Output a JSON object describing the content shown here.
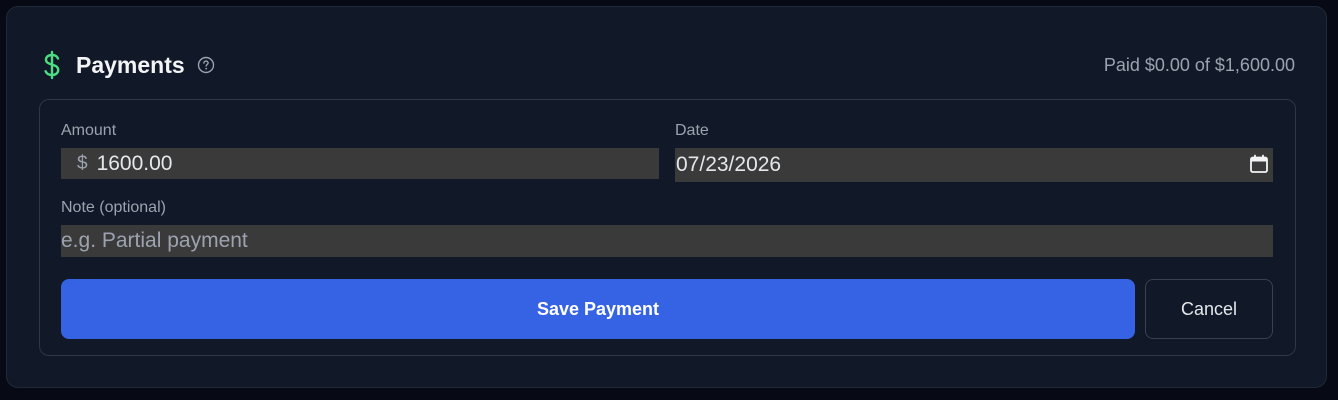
{
  "header": {
    "title": "Payments",
    "paid_summary": "Paid $0.00 of $1,600.00"
  },
  "icons": {
    "title_icon": "dollar-icon",
    "help": "help-circle-icon",
    "date_picker": "calendar-icon"
  },
  "form": {
    "amount": {
      "label": "Amount",
      "prefix": "$",
      "value": "1600.00"
    },
    "date": {
      "label": "Date",
      "value": "07/23/2026"
    },
    "note": {
      "label": "Note (optional)",
      "value": "",
      "placeholder": "e.g. Partial payment"
    },
    "save_label": "Save Payment",
    "cancel_label": "Cancel"
  },
  "colors": {
    "accent": "#3563e3",
    "dollar_icon": "#4ade80",
    "card_bg": "#111827",
    "field_bg": "#3a3a3a"
  }
}
